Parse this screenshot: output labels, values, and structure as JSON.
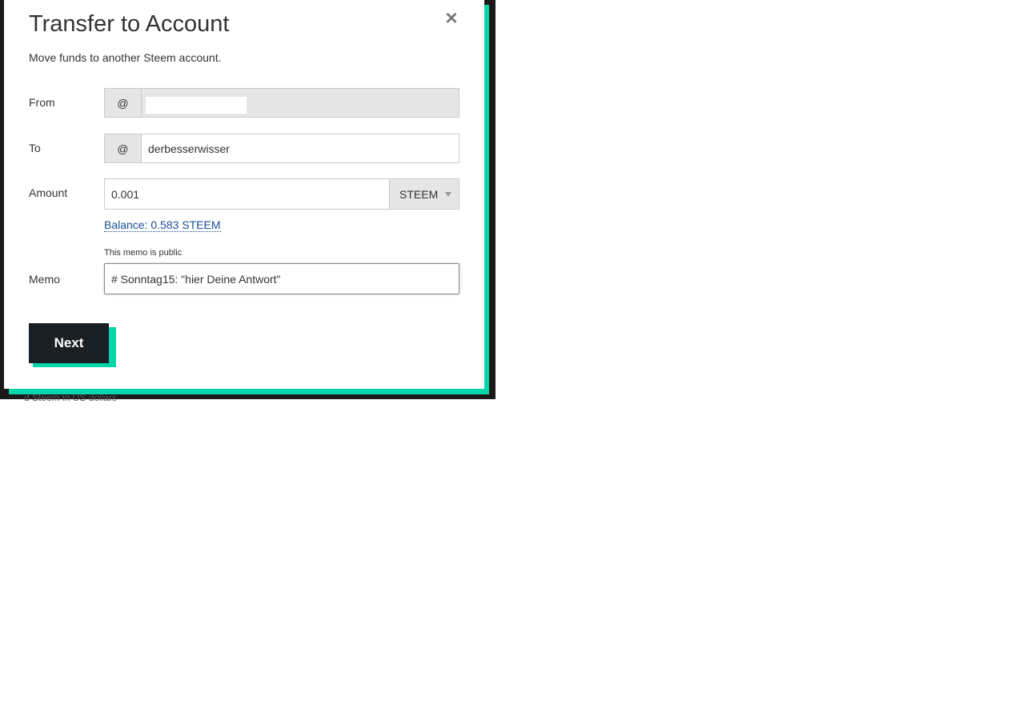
{
  "dialog": {
    "title": "Transfer to Account",
    "subtitle": "Move funds to another Steem account.",
    "close_icon": "×"
  },
  "form": {
    "from": {
      "label": "From",
      "prefix": "@",
      "value": ""
    },
    "to": {
      "label": "To",
      "prefix": "@",
      "value": "derbesserwisser"
    },
    "amount": {
      "label": "Amount",
      "value": "0.001",
      "asset": "STEEM",
      "balance": "Balance: 0.583 STEEM"
    },
    "memo": {
      "label": "Memo",
      "hint": "This memo is public",
      "value": "# Sonntag15: \"hier Deine Antwort\""
    }
  },
  "actions": {
    "next_label": "Next"
  },
  "background": {
    "ghost_text": "d Steem in US dollars"
  },
  "colors": {
    "accent": "#06d6a9",
    "button_bg": "#1a1f24",
    "link": "#1a5099"
  }
}
